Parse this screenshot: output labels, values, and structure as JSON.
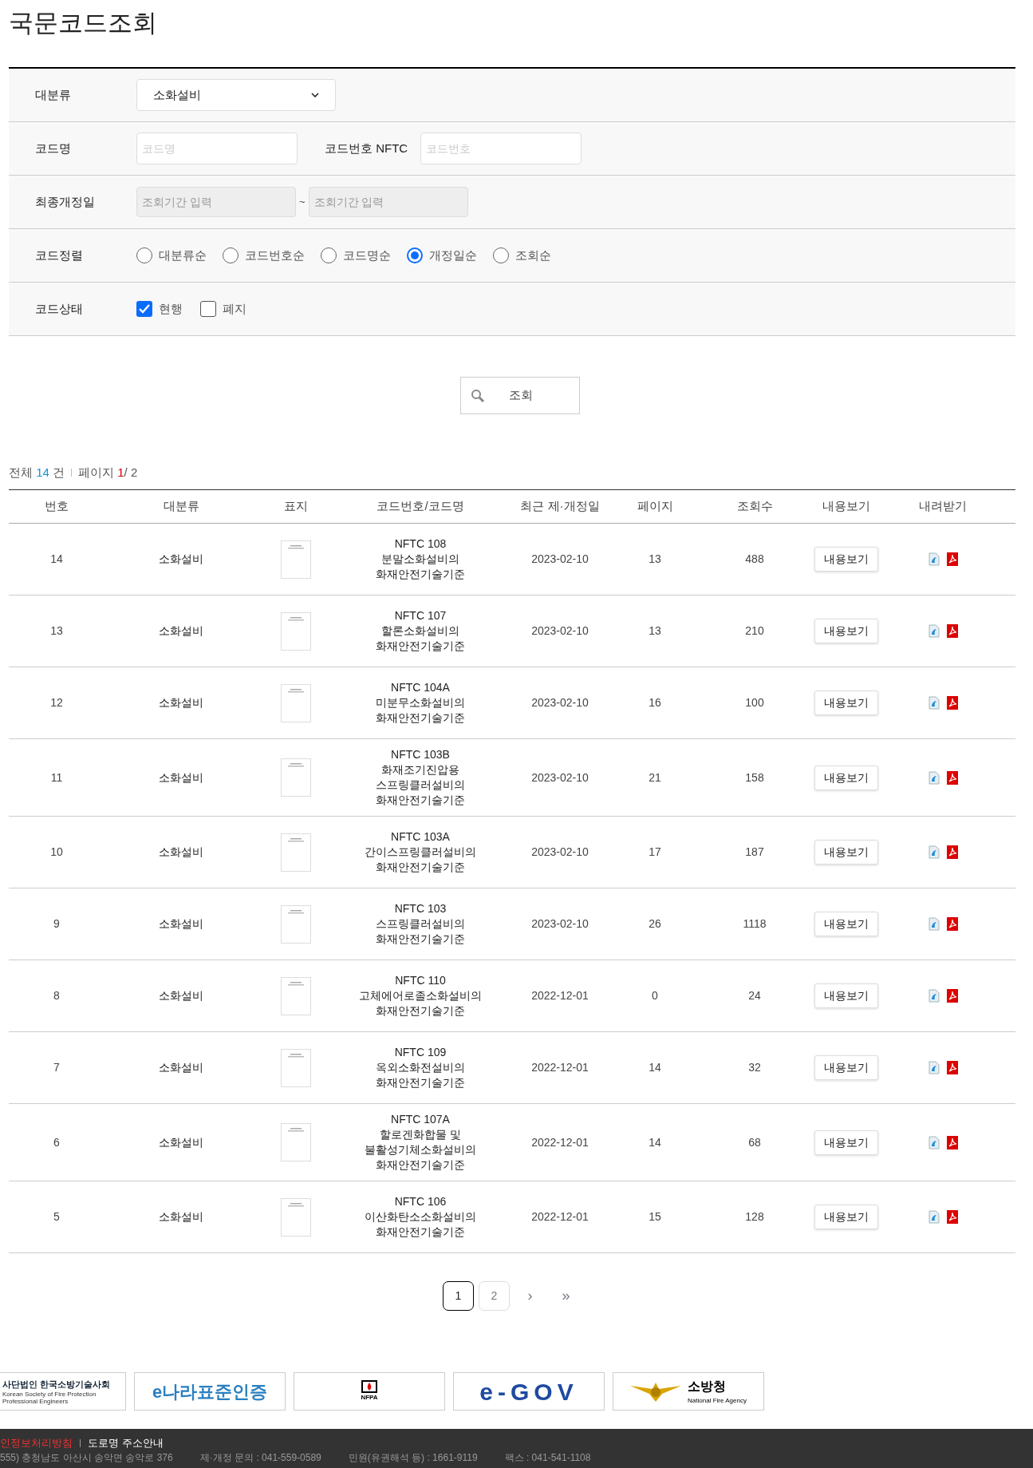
{
  "title": "국문코드조회",
  "form": {
    "category": {
      "label": "대분류",
      "value": "소화설비"
    },
    "code_name": {
      "label": "코드명",
      "placeholder": "코드명"
    },
    "code_number": {
      "label": "코드번호 NFTC",
      "placeholder": "코드번호"
    },
    "revision_date": {
      "label": "최종개정일",
      "from_placeholder": "조회기간 입력",
      "separator": "~",
      "to_placeholder": "조회기간 입력"
    },
    "sort": {
      "label": "코드정렬",
      "options": [
        {
          "label": "대분류순",
          "selected": false
        },
        {
          "label": "코드번호순",
          "selected": false
        },
        {
          "label": "코드명순",
          "selected": false
        },
        {
          "label": "개정일순",
          "selected": true
        },
        {
          "label": "조회순",
          "selected": false
        }
      ]
    },
    "status": {
      "label": "코드상태",
      "options": [
        {
          "label": "현행",
          "checked": true
        },
        {
          "label": "폐지",
          "checked": false
        }
      ]
    },
    "search_button": "조회"
  },
  "summary": {
    "total_label": "전체",
    "total": "14",
    "total_unit": "건",
    "page_label": "페이지",
    "page_current": "1",
    "page_total": "/ 2"
  },
  "table": {
    "columns": [
      "번호",
      "대분류",
      "표지",
      "코드번호/코드명",
      "최근 제·개정일",
      "페이지",
      "조회수",
      "내용보기",
      "내려받기"
    ],
    "rows": [
      {
        "no": "14",
        "category": "소화설비",
        "code": "NFTC 108",
        "name_lines": [
          "분말소화설비의",
          "화재안전기술기준"
        ],
        "date": "2023-02-10",
        "pages": "13",
        "views": "488",
        "view_button": "내용보기"
      },
      {
        "no": "13",
        "category": "소화설비",
        "code": "NFTC 107",
        "name_lines": [
          "할론소화설비의",
          "화재안전기술기준"
        ],
        "date": "2023-02-10",
        "pages": "13",
        "views": "210",
        "view_button": "내용보기"
      },
      {
        "no": "12",
        "category": "소화설비",
        "code": "NFTC 104A",
        "name_lines": [
          "미분무소화설비의",
          "화재안전기술기준"
        ],
        "date": "2023-02-10",
        "pages": "16",
        "views": "100",
        "view_button": "내용보기"
      },
      {
        "no": "11",
        "category": "소화설비",
        "code": "NFTC 103B",
        "name_lines": [
          "화재조기진압용",
          "스프링클러설비의",
          "화재안전기술기준"
        ],
        "date": "2023-02-10",
        "pages": "21",
        "views": "158",
        "view_button": "내용보기"
      },
      {
        "no": "10",
        "category": "소화설비",
        "code": "NFTC 103A",
        "name_lines": [
          "간이스프링클러설비의",
          "화재안전기술기준"
        ],
        "date": "2023-02-10",
        "pages": "17",
        "views": "187",
        "view_button": "내용보기"
      },
      {
        "no": "9",
        "category": "소화설비",
        "code": "NFTC 103",
        "name_lines": [
          "스프링클러설비의",
          "화재안전기술기준"
        ],
        "date": "2023-02-10",
        "pages": "26",
        "views": "1118",
        "view_button": "내용보기"
      },
      {
        "no": "8",
        "category": "소화설비",
        "code": "NFTC 110",
        "name_lines": [
          "고체에어로졸소화설비의",
          "화재안전기술기준"
        ],
        "date": "2022-12-01",
        "pages": "0",
        "views": "24",
        "view_button": "내용보기"
      },
      {
        "no": "7",
        "category": "소화설비",
        "code": "NFTC 109",
        "name_lines": [
          "옥외소화전설비의",
          "화재안전기술기준"
        ],
        "date": "2022-12-01",
        "pages": "14",
        "views": "32",
        "view_button": "내용보기"
      },
      {
        "no": "6",
        "category": "소화설비",
        "code": "NFTC 107A",
        "name_lines": [
          "할로겐화합물 및",
          "불활성기체소화설비의",
          "화재안전기술기준"
        ],
        "date": "2022-12-01",
        "pages": "14",
        "views": "68",
        "view_button": "내용보기"
      },
      {
        "no": "5",
        "category": "소화설비",
        "code": "NFTC 106",
        "name_lines": [
          "이산화탄소소화설비의",
          "화재안전기술기준"
        ],
        "date": "2022-12-01",
        "pages": "15",
        "views": "128",
        "view_button": "내용보기"
      }
    ]
  },
  "pagination": {
    "pages": [
      {
        "label": "1",
        "selected": true
      },
      {
        "label": "2",
        "selected": false
      }
    ],
    "next": "›",
    "last": "»"
  },
  "logos": [
    {
      "kind": "kpfe",
      "text": "사단법인 한국소방기술사회",
      "sub": "Korean Society of Fire Protection Professional Engineers"
    },
    {
      "kind": "enara",
      "text": "e나라표준인증"
    },
    {
      "kind": "nfpa",
      "text": "NFPA"
    },
    {
      "kind": "egov",
      "text": "e-GOV"
    },
    {
      "kind": "nfa",
      "text": "소방청",
      "sub": "National Fire Agency"
    }
  ],
  "footer": {
    "links": [
      {
        "label": "인정보처리방침",
        "kind": "privacy"
      },
      {
        "label": "도로명 주소안내",
        "kind": "normal"
      }
    ],
    "info": [
      "555) 충청남도 아산시 송악면 송악로 376",
      "제·개정 문의 : 041-559-0589",
      "민원(유권해석 등) : 1661-9119",
      "팩스 : 041-541-1108"
    ]
  }
}
